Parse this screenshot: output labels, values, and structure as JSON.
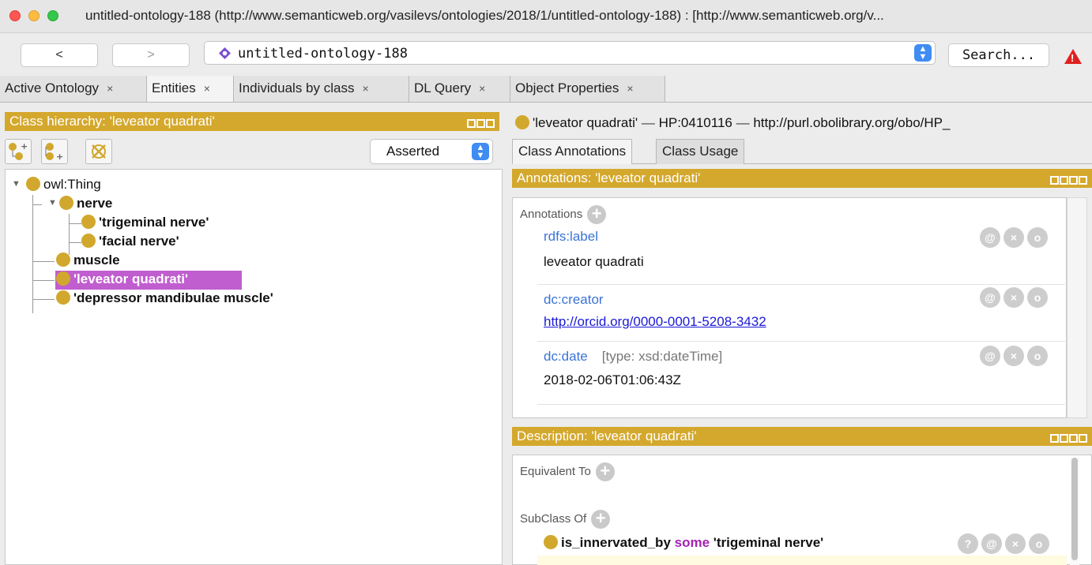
{
  "window": {
    "title": "untitled-ontology-188 (http://www.semanticweb.org/vasilevs/ontologies/2018/1/untitled-ontology-188)  : [http://www.semanticweb.org/v..."
  },
  "toolbar": {
    "back_label": "<",
    "forward_label": ">",
    "ontology_name": "untitled-ontology-188",
    "search_label": "Search...",
    "warning_glyph": "!"
  },
  "tabs": [
    {
      "label": "Active Ontology",
      "close": "×"
    },
    {
      "label": "Entities",
      "close": "×"
    },
    {
      "label": "Individuals by class",
      "close": "×"
    },
    {
      "label": "DL Query",
      "close": "×"
    },
    {
      "label": "Object Properties",
      "close": "×"
    }
  ],
  "class_hierarchy": {
    "header": "Class hierarchy: 'leveator quadrati'",
    "mode": "Asserted",
    "nodes": [
      {
        "label": "owl:Thing"
      },
      {
        "label": "nerve"
      },
      {
        "label": "'trigeminal nerve'"
      },
      {
        "label": "'facial nerve'"
      },
      {
        "label": "muscle"
      },
      {
        "label": "'leveator quadrati'"
      },
      {
        "label": "'depressor mandibulae muscle'"
      }
    ]
  },
  "entity": {
    "name": "'leveator quadrati'",
    "sep1": " — ",
    "id": "HP:0410116",
    "sep2": " — ",
    "iri": "http://purl.obolibrary.org/obo/HP_"
  },
  "subtabs": [
    "Class Annotations",
    "Class Usage"
  ],
  "annotations": {
    "header": "Annotations: 'leveator quadrati'",
    "section_label": "Annotations",
    "items": [
      {
        "property": "rdfs:label",
        "type": "",
        "value": "leveator quadrati"
      },
      {
        "property": "dc:creator",
        "type": "",
        "value": "http://orcid.org/0000-0001-5208-3432"
      },
      {
        "property": "dc:date",
        "type": "[type: xsd:dateTime]",
        "value": "2018-02-06T01:06:43Z"
      }
    ],
    "action_icons": [
      "@",
      "×",
      "o"
    ]
  },
  "description": {
    "header": "Description: 'leveator quadrati'",
    "equivalent_label": "Equivalent To",
    "subclass_label": "SubClass Of",
    "subclass_expr": {
      "property": "is_innervated_by",
      "keyword": "some",
      "filler": "'trigeminal nerve'"
    },
    "action_icons": [
      "?",
      "@",
      "×",
      "o"
    ]
  },
  "colors": {
    "panel_header": "#d4a82c",
    "class_dot": "#d1a82d",
    "selection": "#c05ecf",
    "property_link": "#3a74d6",
    "keyword": "#a323b0"
  }
}
